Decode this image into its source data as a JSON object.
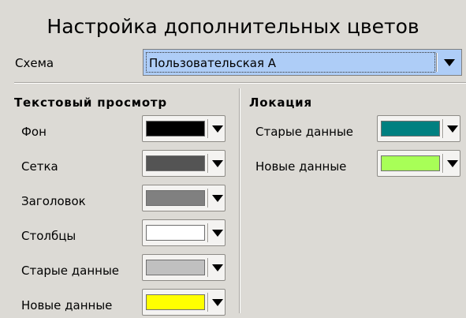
{
  "dialog": {
    "title": "Настройка дополнительных цветов"
  },
  "scheme": {
    "label": "Схема",
    "selected": "Пользовательская A"
  },
  "text_view": {
    "heading": "Текстовый просмотр",
    "rows": [
      {
        "label": "Фон",
        "color": "#000000"
      },
      {
        "label": "Сетка",
        "color": "#545454"
      },
      {
        "label": "Заголовок",
        "color": "#808080"
      },
      {
        "label": "Столбцы",
        "color": "#ffffff"
      },
      {
        "label": "Старые данные",
        "color": "#c0c0c0"
      },
      {
        "label": "Новые данные",
        "color": "#ffff00"
      }
    ]
  },
  "location": {
    "heading": "Локация",
    "rows": [
      {
        "label": "Старые данные",
        "color": "#008080"
      },
      {
        "label": "Новые данные",
        "color": "#a8ff57"
      }
    ]
  },
  "icons": {
    "dropdown": "chevron-down-icon"
  }
}
